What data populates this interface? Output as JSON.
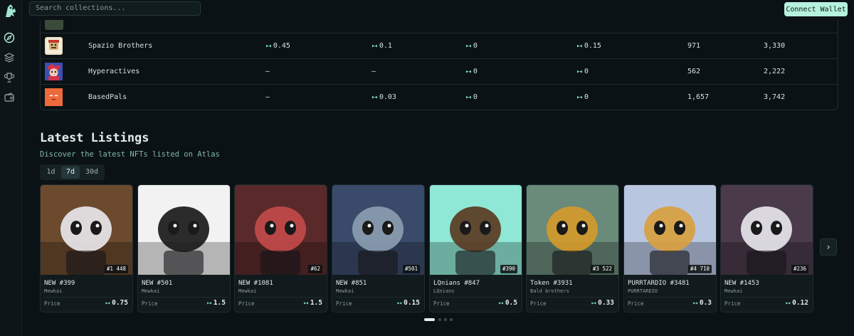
{
  "search": {
    "placeholder": "Search collections..."
  },
  "header": {
    "connect_label": "Connect Wallet"
  },
  "sidebar": {
    "items": [
      "compass-icon",
      "layers-icon",
      "trophy-icon",
      "wallet-icon"
    ]
  },
  "table": {
    "rows": [
      {
        "name": "Spazio Brothers",
        "c1": "0.45",
        "c2": "0.1",
        "c3": "0",
        "c4": "0.15",
        "c5": "971",
        "c6": "3,330",
        "thumb_color": "#e8e0c6"
      },
      {
        "name": "Hyperactives",
        "c1": "–",
        "c2": "–",
        "c3": "0",
        "c4": "0",
        "c5": "562",
        "c6": "2,222",
        "thumb_color": "#4a3f8a"
      },
      {
        "name": "BasedPals",
        "c1": "–",
        "c2": "0.03",
        "c3": "0",
        "c4": "0",
        "c5": "1,657",
        "c6": "3,742",
        "thumb_color": "#ef6a3a"
      }
    ]
  },
  "listings": {
    "title": "Latest Listings",
    "subtitle": "Discover the latest NFTs listed on Atlas",
    "tabs": [
      "1d",
      "7d",
      "30d"
    ],
    "active_tab": "7d",
    "price_label": "Price",
    "cards": [
      {
        "name": "NEW #399",
        "collection": "Mewkai",
        "price": "0.75",
        "badge": "#1 448",
        "bg": "#6b4a2e",
        "accent": "#e8e6ea"
      },
      {
        "name": "NEW #501",
        "collection": "Mewkai",
        "price": "1.5",
        "badge": "",
        "bg": "#f2f2f2",
        "accent": "#1a1a1a"
      },
      {
        "name": "NEW #1081",
        "collection": "Mewkai",
        "price": "1.5",
        "badge": "#62",
        "bg": "#5a2a2a",
        "accent": "#c24a4a"
      },
      {
        "name": "NEW #851",
        "collection": "Mewkai",
        "price": "0.15",
        "badge": "#501",
        "bg": "#3a4a6a",
        "accent": "#8a9cb0"
      },
      {
        "name": "LQnians #847",
        "collection": "LQnians",
        "price": "0.5",
        "badge": "#390",
        "bg": "#8fe8d6",
        "accent": "#5a3a22"
      },
      {
        "name": "Token #3931",
        "collection": "Bald brothers",
        "price": "0.33",
        "badge": "#3 522",
        "bg": "#6a8a7a",
        "accent": "#d49a2a"
      },
      {
        "name": "PURRTARDIO #3481",
        "collection": "PURRTARDIO",
        "price": "0.3",
        "badge": "#4 710",
        "bg": "#b9c6e0",
        "accent": "#d8a040"
      },
      {
        "name": "NEW #1453",
        "collection": "Mewkai",
        "price": "0.12",
        "badge": "#236",
        "bg": "#4a3a4a",
        "accent": "#e6e6ea"
      }
    ]
  },
  "colors": {
    "accent": "#b6f2de",
    "background": "#0b1215",
    "price_symbol": "#7de3c1"
  }
}
